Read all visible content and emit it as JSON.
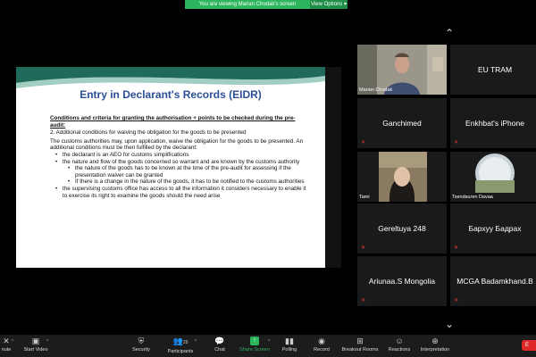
{
  "banner": {
    "viewing": "You are viewing Marian Chodak's screen",
    "options": "View Options ▾"
  },
  "slide": {
    "title": "Entry in Declarant's Records (EIDR)",
    "heading": "Conditions and criteria for granting the authorisation + points to be checked during the pre-audit:",
    "point": "2.  Additional conditions for waiving the obligation for the goods to be presented",
    "para": "The customs authorities may, upon application, waive the obligation for the goods to be presented. An additional conditions must be then fulfilled by the declarant:",
    "bullets": [
      "the declarant is an AEO for customs simplifications",
      "the nature and flow of the goods concerned so warrant and are known by the customs authority"
    ],
    "subbullets": [
      "the nature of the goods has to be known at the time of the pre-audit for assessing if the presentation waiver can be granted",
      "If there is a change in the nature of the goods, it has to be notified to the customs authorities"
    ],
    "last_bullet": "the supervising customs office has access to all the information it considers necessary to enable it to exercise its right to examine the goods should the need arise"
  },
  "gallery": {
    "up_arrow": "⌃",
    "down_arrow": "⌄",
    "tiles": [
      {
        "name": "Marian Chodak"
      },
      {
        "name": "EU TRAM"
      },
      {
        "name": "Ganchimed"
      },
      {
        "name": "Enkhbat's iPhone"
      },
      {
        "name": "Tami"
      },
      {
        "name": "Tsendsuren Davaa"
      },
      {
        "name": "Gereltuya 248"
      },
      {
        "name": "Бархуу Бадрах"
      },
      {
        "name": "Ariunaa.S Mongolia"
      },
      {
        "name": "MCGA Badamkhand.B"
      }
    ]
  },
  "toolbar": {
    "unmute": "nute",
    "start_video": "Start Video",
    "security": "Security",
    "participants": "Participants",
    "participants_count": "29",
    "chat": "Chat",
    "share_screen": "Share Screen",
    "polling": "Polling",
    "record": "Record",
    "breakout": "Breakout Rooms",
    "reactions": "Reactions",
    "interpretation": "Interpretation",
    "end": "E"
  },
  "colors": {
    "accent_green": "#2db55d",
    "active_speaker": "#c8e34b",
    "muted_red": "#e53a3a",
    "slide_title": "#2c4f9a"
  }
}
